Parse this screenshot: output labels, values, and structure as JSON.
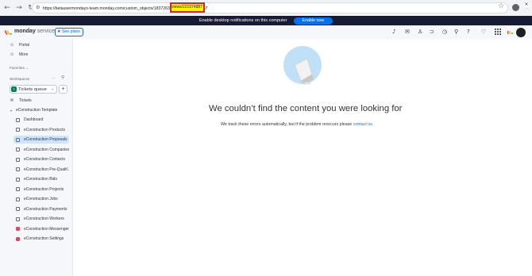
{
  "browser": {
    "url": "https://betausermondays-team.monday.com/custom_objects/183726389/views/221974887",
    "url_selected": "views/221974887"
  },
  "notification": {
    "text": "Enable desktop notifications on this computer",
    "button": "Enable now"
  },
  "topnav": {
    "brand_bold": "monday",
    "brand_light": "service",
    "see_plans": "See plans",
    "icons": [
      "bell-icon",
      "inbox-icon",
      "invite-members-icon",
      "integrations-icon",
      "help-tv-icon",
      "search-icon",
      "help-icon",
      "update-feed-icon",
      "apps-grid-icon"
    ]
  },
  "sidebar": {
    "top_items": [
      {
        "label": "Portal",
        "icon": "portal-icon"
      },
      {
        "label": "More",
        "icon": "more-icon"
      }
    ],
    "favorites_label": "Favorites",
    "workspaces_label": "Workspaces",
    "workspace": {
      "badge": "T",
      "name": "Tickets queue"
    },
    "tickets_label": "Tickets",
    "folder_label": "eConstruction Template",
    "boards": [
      {
        "label": "Dashboard",
        "type": "dashboard"
      },
      {
        "label": "eConstruction Products",
        "type": "board"
      },
      {
        "label": "eConstruction Proposals",
        "type": "board",
        "active": true
      },
      {
        "label": "eConstruction Companies",
        "type": "board"
      },
      {
        "label": "eConstruction Contacts",
        "type": "board"
      },
      {
        "label": "eConstruction Pre-Qualif...",
        "type": "board"
      },
      {
        "label": "eConstruction Bids",
        "type": "board"
      },
      {
        "label": "eConstruction Projects",
        "type": "board"
      },
      {
        "label": "eConstruction Jobs",
        "type": "board"
      },
      {
        "label": "eConstruction Payments",
        "type": "board"
      },
      {
        "label": "eConstruction Workers",
        "type": "board"
      },
      {
        "label": "eConstruction Messenger",
        "type": "app"
      },
      {
        "label": "eConstruction Settings",
        "type": "app"
      }
    ]
  },
  "main": {
    "title": "We couldn’t find the content you were looking for",
    "subtitle_prefix": "We track these errors automatically, but if the problem reoccurs please ",
    "subtitle_link": "contact us."
  },
  "colors": {
    "accent": "#0073ea",
    "notif_bg": "#181b34",
    "active_item": "#cce5ff",
    "highlight_box": "#d62828"
  }
}
